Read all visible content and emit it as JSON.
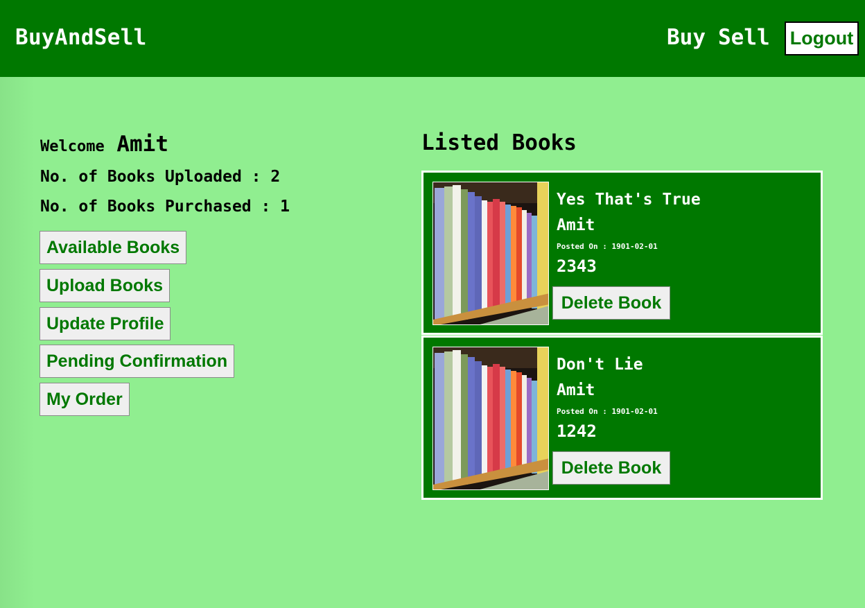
{
  "nav": {
    "brand": "BuyAndSell",
    "buy": "Buy",
    "sell": "Sell",
    "logout": "Logout"
  },
  "profile": {
    "welcome_label": "Welcome",
    "user_name": "Amit",
    "uploaded_label": "No. of Books Uploaded : 2",
    "purchased_label": "No. of Books Purchased : 1"
  },
  "sidebar": {
    "buttons": [
      "Available Books",
      "Upload Books",
      "Update Profile",
      "Pending Confirmation",
      "My Order"
    ]
  },
  "listed": {
    "title": "Listed Books",
    "books": [
      {
        "title": "Yes That's True",
        "author": "Amit",
        "posted": "Posted On : 1901-02-01",
        "price": "2343",
        "delete_label": "Delete Book",
        "cover_icon": "bookshelf-image"
      },
      {
        "title": "Don't Lie",
        "author": "Amit",
        "posted": "Posted On : 1901-02-01",
        "price": "1242",
        "delete_label": "Delete Book",
        "cover_icon": "bookshelf-image"
      }
    ]
  },
  "colors": {
    "nav_bg": "#007800",
    "page_bg": "#90ee90",
    "card_bg": "#007800",
    "button_text": "#007800"
  }
}
